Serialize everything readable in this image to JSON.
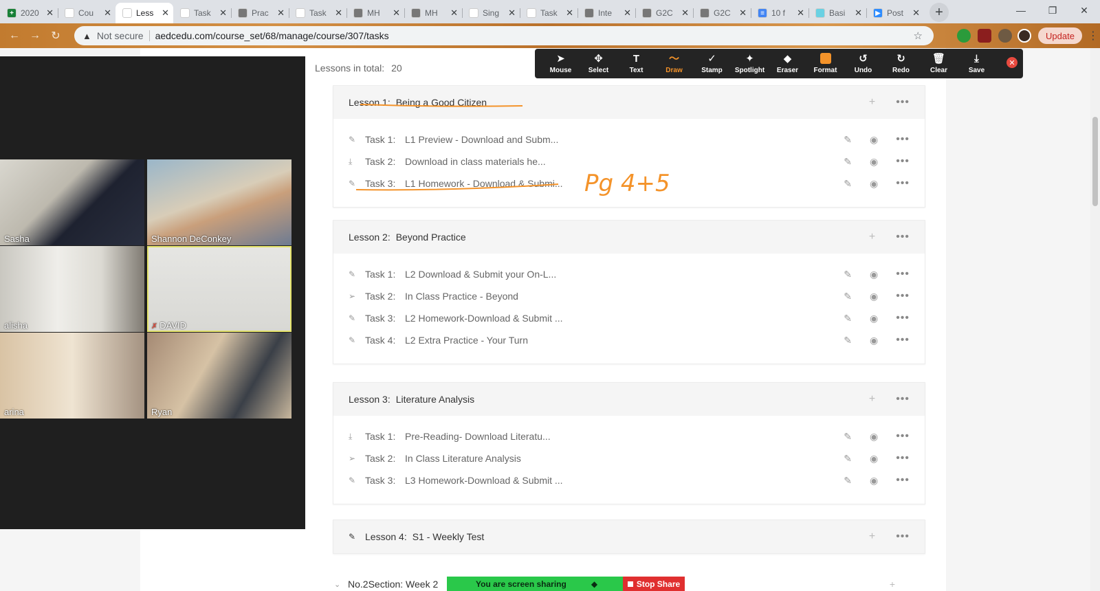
{
  "browser": {
    "tabs": [
      {
        "title": "2020",
        "favicon": "#188038",
        "glyph": "+"
      },
      {
        "title": "Cou",
        "favicon": "#fff",
        "glyph": ""
      },
      {
        "title": "Less",
        "favicon": "#fff",
        "glyph": "",
        "active": true
      },
      {
        "title": "Task",
        "favicon": "#fff",
        "glyph": ""
      },
      {
        "title": "Prac",
        "favicon": "#777",
        "glyph": ""
      },
      {
        "title": "Task",
        "favicon": "#fff",
        "glyph": ""
      },
      {
        "title": "MH",
        "favicon": "#777",
        "glyph": ""
      },
      {
        "title": "MH",
        "favicon": "#777",
        "glyph": ""
      },
      {
        "title": "Sing",
        "favicon": "#fff",
        "glyph": ""
      },
      {
        "title": "Task",
        "favicon": "#fff",
        "glyph": ""
      },
      {
        "title": "Inte",
        "favicon": "#777",
        "glyph": ""
      },
      {
        "title": "G2C",
        "favicon": "#777",
        "glyph": ""
      },
      {
        "title": "G2C",
        "favicon": "#777",
        "glyph": ""
      },
      {
        "title": "10 f",
        "favicon": "#4285f4",
        "glyph": "≡"
      },
      {
        "title": "Basi",
        "favicon": "#6ad1e3",
        "glyph": ""
      },
      {
        "title": "Post",
        "favicon": "#2d8cff",
        "glyph": "▶"
      }
    ],
    "security_label": "Not secure",
    "url": "aedcedu.com/course_set/68/manage/course/307/tasks",
    "update_label": "Update",
    "extension_badge": "1"
  },
  "course": {
    "lessons_total_label": "Lessons in total:",
    "lessons_total": "20",
    "lessons": [
      {
        "prefix": "Lesson 1:",
        "title": "Being a Good Citizen",
        "tasks": [
          {
            "icon": "pencil",
            "label": "Task 1:",
            "title": "L1 Preview - Download and Subm..."
          },
          {
            "icon": "download",
            "label": "Task 2:",
            "title": "Download in class materials he..."
          },
          {
            "icon": "pencil",
            "label": "Task 3:",
            "title": "L1 Homework - Download & Submi..."
          }
        ]
      },
      {
        "prefix": "Lesson 2:",
        "title": "Beyond Practice",
        "tasks": [
          {
            "icon": "pencil",
            "label": "Task 1:",
            "title": "L2 Download & Submit your On-L..."
          },
          {
            "icon": "send",
            "label": "Task 2:",
            "title": "In Class Practice - Beyond"
          },
          {
            "icon": "pencil",
            "label": "Task 3:",
            "title": "L2 Homework-Download & Submit ..."
          },
          {
            "icon": "pencil",
            "label": "Task 4:",
            "title": "L2 Extra Practice - Your Turn"
          }
        ]
      },
      {
        "prefix": "Lesson 3:",
        "title": "Literature Analysis",
        "tasks": [
          {
            "icon": "download",
            "label": "Task 1:",
            "title": "Pre-Reading- Download Literatu..."
          },
          {
            "icon": "send",
            "label": "Task 2:",
            "title": "In Class Literature Analysis"
          },
          {
            "icon": "pencil",
            "label": "Task 3:",
            "title": "L3 Homework-Download & Submit ..."
          }
        ]
      },
      {
        "prefix": "Lesson 4:",
        "title": "S1 - Weekly Test",
        "tasks": []
      }
    ],
    "next_section": "No.2Section:  Week 2"
  },
  "zoom": {
    "participants": [
      {
        "name": "Sasha"
      },
      {
        "name": "Shannon DeConkey"
      },
      {
        "name": "alisha"
      },
      {
        "name": "DAVID",
        "muted": true,
        "active": true
      },
      {
        "name": "arina"
      },
      {
        "name": "Ryan"
      }
    ],
    "tools": [
      {
        "name": "mouse",
        "label": "Mouse",
        "glyph": "➤"
      },
      {
        "name": "select",
        "label": "Select",
        "glyph": "✥"
      },
      {
        "name": "text",
        "label": "Text",
        "glyph": "T"
      },
      {
        "name": "draw",
        "label": "Draw",
        "glyph": "〜",
        "active": true
      },
      {
        "name": "stamp",
        "label": "Stamp",
        "glyph": "✓"
      },
      {
        "name": "spotlight",
        "label": "Spotlight",
        "glyph": "✦"
      },
      {
        "name": "eraser",
        "label": "Eraser",
        "glyph": "◆"
      },
      {
        "name": "format",
        "label": "Format",
        "glyph": ""
      },
      {
        "name": "undo",
        "label": "Undo",
        "glyph": "↺"
      },
      {
        "name": "redo",
        "label": "Redo",
        "glyph": "↻"
      },
      {
        "name": "clear",
        "label": "Clear",
        "glyph": "🗑"
      },
      {
        "name": "save",
        "label": "Save",
        "glyph": "⤓"
      }
    ],
    "share_status": "You are screen sharing",
    "stop_share_label": "Stop Share",
    "accent_color": "#f4932a"
  },
  "annotation_text": "Pg 4+5"
}
